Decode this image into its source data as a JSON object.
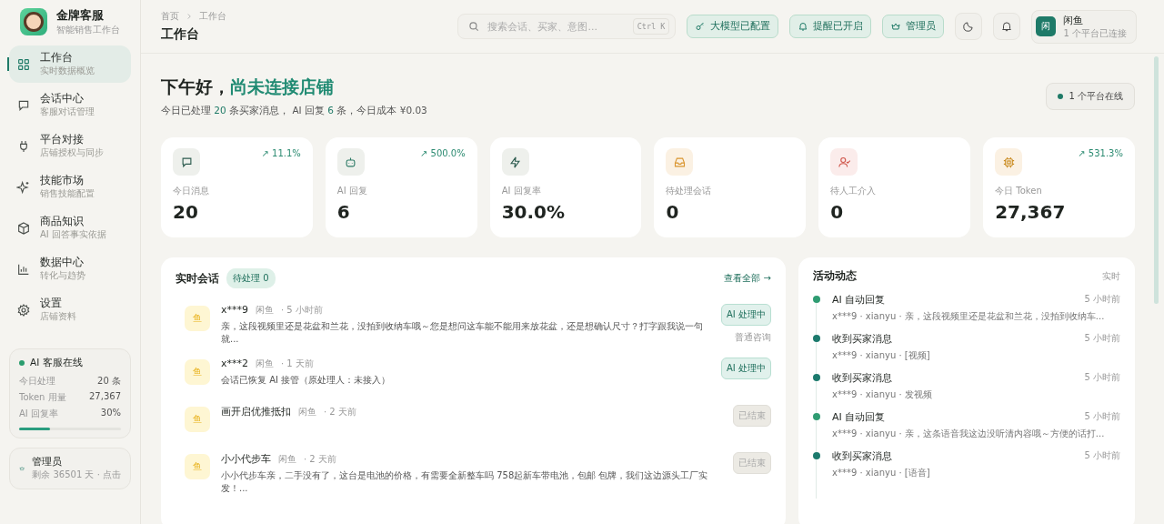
{
  "brand": {
    "name": "金牌客服",
    "subtitle": "智能销售工作台"
  },
  "nav": [
    {
      "kind": "grid",
      "label": "工作台",
      "sub": "实时数据概览",
      "selected": true
    },
    {
      "kind": "chat",
      "label": "会话中心",
      "sub": "客服对话管理",
      "selected": false
    },
    {
      "kind": "plug",
      "label": "平台对接",
      "sub": "店铺授权与同步",
      "selected": false
    },
    {
      "kind": "sparkle",
      "label": "技能市场",
      "sub": "销售技能配置",
      "selected": false
    },
    {
      "kind": "box",
      "label": "商品知识",
      "sub": "AI 回答事实依据",
      "selected": false
    },
    {
      "kind": "chart",
      "label": "数据中心",
      "sub": "转化与趋势",
      "selected": false
    },
    {
      "kind": "gear",
      "label": "设置",
      "sub": "店铺资料",
      "selected": false
    }
  ],
  "ai_status": {
    "title": "AI 客服在线",
    "online": true,
    "rows": [
      {
        "label": "今日处理",
        "value": "20 条"
      },
      {
        "label": "Token 用量",
        "value": "27,367"
      },
      {
        "label": "AI 回复率",
        "value": "30%"
      }
    ],
    "level": 0.3
  },
  "admin_card": {
    "title": "管理员",
    "sub": "剩余 36501 天 · 点击"
  },
  "breadcrumb": [
    "首页",
    "工作台"
  ],
  "page_title": "工作台",
  "search": {
    "placeholder": "搜索会话、买家、意图...",
    "shortcut": "Ctrl K"
  },
  "header_chips": [
    {
      "kind": "key",
      "label": "大模型已配置"
    },
    {
      "kind": "bell",
      "label": "提醒已开启"
    },
    {
      "kind": "crown",
      "label": "管理员"
    }
  ],
  "account": {
    "avatar": "闲",
    "name": "闲鱼",
    "sub": "1 个平台已连接"
  },
  "greeting": {
    "title": "下午好，",
    "highlight": "尚未连接店铺",
    "summary": "今日已处理 **20** 条买家消息， AI 回复 **6** 条，今日成本 ¥0.03"
  },
  "online_badge": "1 个平台在线",
  "stats": [
    {
      "kind": "chat",
      "label": "今日消息",
      "value": "20",
      "trend": "↗ 11.1%"
    },
    {
      "kind": "robot",
      "label": "AI 回复",
      "value": "6",
      "trend": "↗ 500.0%"
    },
    {
      "kind": "bolt",
      "label": "AI 回复率",
      "value": "30.0%"
    },
    {
      "kind": "inbox",
      "label": "待处理会话",
      "value": "0"
    },
    {
      "kind": "user",
      "label": "待人工介入",
      "value": "0"
    },
    {
      "kind": "chip",
      "label": "今日 Token",
      "value": "27,367",
      "trend": "↗ 531.3%"
    }
  ],
  "conversations": {
    "title": "实时会话",
    "pending": "待处理 0",
    "view_all": "查看全部 →",
    "items": [
      {
        "avatar": "鱼",
        "name": "x***9",
        "platform": "闲鱼",
        "time": "· 5 小时前",
        "message": "亲，这段视频里还是花盆和兰花，没拍到收纳车哦～您是想问这车能不能用来放花盆，还是想确认尺寸？打字跟我说一句就...",
        "status": "AI 处理中",
        "kind": "active",
        "tag": "普通咨询"
      },
      {
        "avatar": "鱼",
        "name": "x***2",
        "platform": "闲鱼",
        "time": "· 1 天前",
        "message": "会话已恢复 AI 接管（原处理人：未接入）",
        "status": "AI 处理中",
        "kind": "active"
      },
      {
        "avatar": "鱼",
        "name": "画开启优推抵扣",
        "platform": "闲鱼",
        "time": "· 2 天前",
        "status": "已结束",
        "kind": "ended"
      },
      {
        "avatar": "鱼",
        "name": "小小代步车",
        "platform": "闲鱼",
        "time": "· 2 天前",
        "message": "小小代步车亲，二手没有了，这台是电池的价格，有需要全新整车吗 758起新车带电池，包邮 包牌，我们这边源头工厂实发！...",
        "status": "已结束",
        "kind": "ended"
      }
    ]
  },
  "activity": {
    "title": "活动动态",
    "badge": "实时",
    "items": [
      {
        "kind": "ai_reply",
        "title": "AI 自动回复",
        "time": "5 小时前",
        "detail": "x***9 · xianyu · 亲，这段视频里还是花盆和兰花，没拍到收纳车..."
      },
      {
        "kind": "buyer_message",
        "title": "收到买家消息",
        "time": "5 小时前",
        "detail": "x***9 · xianyu · [视频]"
      },
      {
        "kind": "buyer_message",
        "title": "收到买家消息",
        "time": "5 小时前",
        "detail": "x***9 · xianyu · 发视频"
      },
      {
        "kind": "ai_reply",
        "title": "AI 自动回复",
        "time": "5 小时前",
        "detail": "x***9 · xianyu · 亲，这条语音我这边没听清内容哦～方便的话打..."
      },
      {
        "kind": "buyer_message",
        "title": "收到买家消息",
        "time": "5 小时前",
        "detail": "x***9 · xianyu · [语音]"
      }
    ]
  }
}
